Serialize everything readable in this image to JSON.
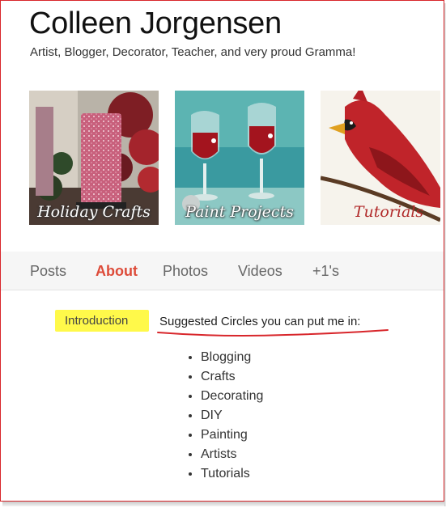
{
  "profile": {
    "name": "Colleen Jorgensen",
    "tagline": "Artist, Blogger, Decorator, Teacher, and very proud Gramma!"
  },
  "photos": [
    {
      "label": "Holiday Crafts"
    },
    {
      "label": "Paint Projects"
    },
    {
      "label": "Tutorials"
    }
  ],
  "tabs": [
    {
      "label": "Posts",
      "active": false
    },
    {
      "label": "About",
      "active": true
    },
    {
      "label": "Photos",
      "active": false
    },
    {
      "label": "Videos",
      "active": false
    },
    {
      "label": "+1's",
      "active": false
    }
  ],
  "about": {
    "section_label": "Introduction",
    "circles_title": "Suggested Circles you can put me in:",
    "circles": [
      "Blogging",
      "Crafts",
      "Decorating",
      "DIY",
      "Painting",
      "Artists",
      "Tutorials"
    ]
  },
  "colors": {
    "active_tab": "#dd4b39",
    "highlight": "#fff94a",
    "annotation": "#d8262b"
  }
}
